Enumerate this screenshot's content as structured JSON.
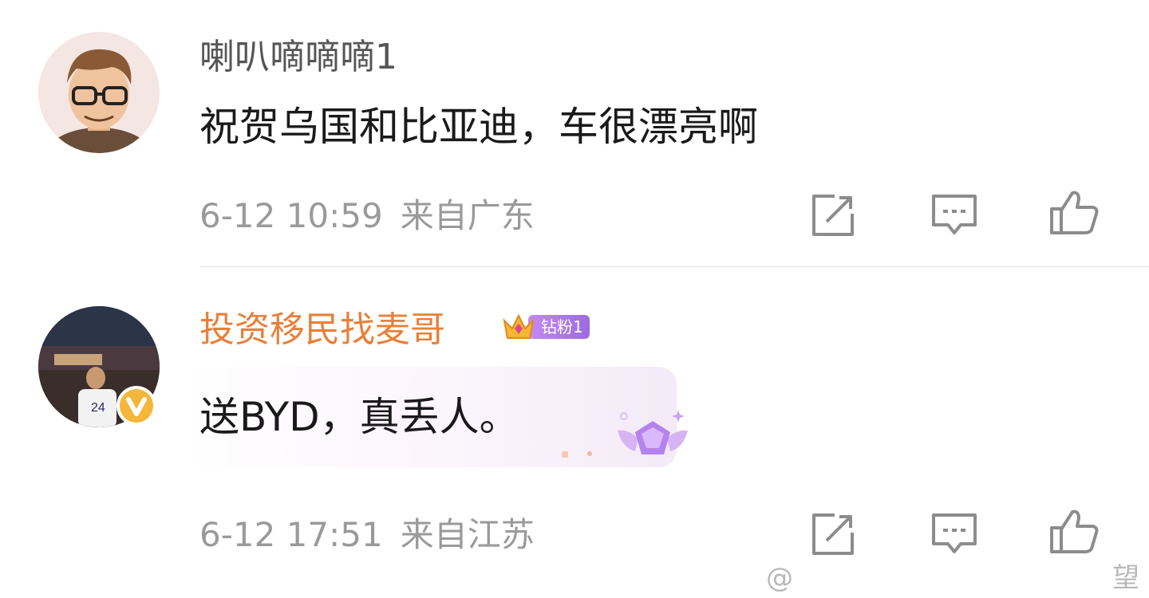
{
  "comments": [
    {
      "username": "喇叭嘀嘀嘀1",
      "text": "祝贺乌国和比亚迪，车很漂亮啊",
      "date": "6-12 10:59",
      "location": "来自广东"
    },
    {
      "username": "投资移民找麦哥",
      "badge": "钻粉1",
      "text": "送BYD，真丢人。",
      "date": "6-12 17:51",
      "location": "来自江苏"
    }
  ],
  "watermark": {
    "logo": "@",
    "text": "望"
  },
  "colors": {
    "name_gray": "#555555",
    "name_orange": "#e8803a",
    "meta_gray": "#9a9a9a",
    "icon_gray": "#8c8c8c",
    "vip_gold": "#f4b73a"
  },
  "icons": [
    "share-icon",
    "comment-icon",
    "like-icon",
    "verified-v-icon",
    "crown-icon",
    "diamond-wings-icon"
  ]
}
